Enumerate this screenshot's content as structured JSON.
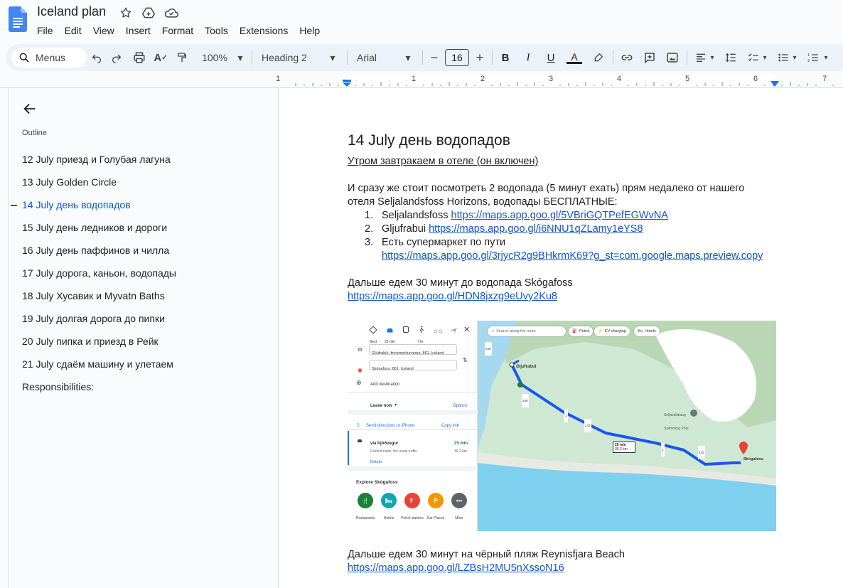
{
  "app": {
    "doc_title": "Iceland plan",
    "menu": [
      "File",
      "Edit",
      "View",
      "Insert",
      "Format",
      "Tools",
      "Extensions",
      "Help"
    ]
  },
  "toolbar": {
    "search_label": "Menus",
    "zoom": "100%",
    "style": "Heading 2",
    "font": "Arial",
    "font_size": "16"
  },
  "ruler": {
    "marks": [
      "1",
      "1",
      "2",
      "3",
      "4",
      "5",
      "6",
      "7"
    ]
  },
  "outline": {
    "label": "Outline",
    "items": [
      {
        "label": "12 July приезд и Голубая лагуна"
      },
      {
        "label": "13 July Golden Circle"
      },
      {
        "label": "14 July день водопадов"
      },
      {
        "label": "15 July день ледников и дороги"
      },
      {
        "label": "16 July день паффинов и чилла"
      },
      {
        "label": "17 July дорога, каньон, водопады"
      },
      {
        "label": "18 July Хусавик и Myvatn Baths"
      },
      {
        "label": "19 July долгая дорога до пипки"
      },
      {
        "label": "20 July пипка и приезд в Рейк"
      },
      {
        "label": "21 July сдаём машину и улетаем"
      },
      {
        "label": "Responsibilities:"
      }
    ]
  },
  "doc": {
    "heading": "14 July день водопадов",
    "breakfast": "Утром завтракаем в отеле (он включен)",
    "intro_line1": "И сразу же стоит посмотреть 2 водопада (5 минут ехать) прям недалеко от нашего",
    "intro_line2": "отеля Seljalandsfoss Horizons, водопады БЕСПЛАТНЫЕ:",
    "list": [
      {
        "num": "1.",
        "text": "Seljalandsfoss ",
        "link": "https://maps.app.goo.gl/5VBriGQTPefEGWvNA"
      },
      {
        "num": "2.",
        "text": "Gljufrabui ",
        "link": "https://maps.app.goo.gl/i6NNU1qZLamy1eYS8"
      },
      {
        "num": "3.",
        "text": "Есть супермаркет по пути",
        "link": "https://maps.app.goo.gl/3rjycR2g9BHkrmK69?g_st=com.google.maps.preview.copy"
      }
    ],
    "skogafoss_text": "Дальше едем 30 минут до водопада Skógafoss",
    "skogafoss_link": "https://maps.app.goo.gl/HDN8jxzg9eUvy2Ku8",
    "beach_text": "Дальше едем 30 минут на чёрный пляж Reynisfjara Beach",
    "beach_link": "https://maps.app.goo.gl/LZBsH2MU5nXssoN16"
  },
  "map_screenshot": {
    "modes": [
      "Best",
      "25 min",
      "",
      "7 hr"
    ],
    "origin": "Gljúfrabúi, Þórsmerkurvegur, 861, Iceland",
    "destination": "Skógafoss, 861, Iceland",
    "add_destination": "Add destination",
    "leave_now": "Leave now",
    "options": "Options",
    "send_directions": "Send directions to iPhone",
    "copy_link": "Copy link",
    "route_via": "via Þjóðvegur",
    "route_time": "25 min",
    "route_desc": "Fastest route, the usual traffic",
    "route_dist": "30.2 km",
    "details": "Details",
    "explore_title": "Explore Skógafoss",
    "explore": [
      {
        "label": "Restaurants",
        "color": "#188038",
        "glyph": "🍴"
      },
      {
        "label": "Hotels",
        "color": "#12a4af",
        "glyph": "🛏"
      },
      {
        "label": "Petrol stations",
        "color": "#ea4335",
        "glyph": "⛽"
      },
      {
        "label": "Car Places",
        "color": "#f29900",
        "glyph": "P"
      },
      {
        "label": "More",
        "color": "#5f6368",
        "glyph": "•••"
      }
    ],
    "search_along": "Search along the route",
    "chips": [
      "Petrol",
      "EV charging",
      "Hotels"
    ],
    "place_start": "Gljufrabui",
    "place_end": "Skógafoss",
    "pool": "Seljavallalaug Swimming Pool",
    "route_badge_time": "25 min",
    "route_badge_dist": "30.2 km",
    "road_labels": [
      "249",
      "1",
      "242",
      "1",
      "242",
      "249"
    ]
  },
  "colors": {
    "accent": "#0b57d0",
    "link": "#1155cc",
    "route": "#1a56f0"
  }
}
